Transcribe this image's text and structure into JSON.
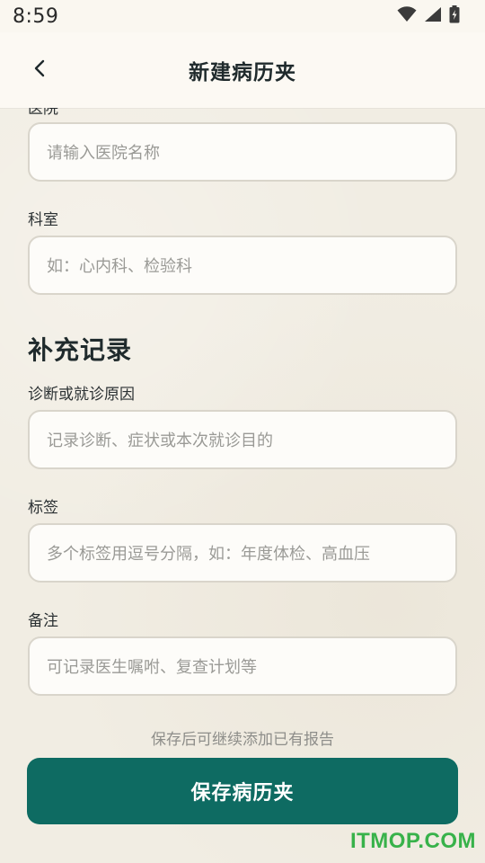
{
  "status_bar": {
    "time": "8:59",
    "icons": [
      "wifi-icon",
      "signal-icon",
      "battery-icon"
    ]
  },
  "app_bar": {
    "title": "新建病历夹",
    "back_icon": "back-arrow-icon"
  },
  "form": {
    "hospital": {
      "label": "医院",
      "placeholder": "请输入医院名称"
    },
    "department": {
      "label": "科室",
      "placeholder": "如：心内科、检验科"
    },
    "supplement_section_title": "补充记录",
    "diagnosis": {
      "label": "诊断或就诊原因",
      "placeholder": "记录诊断、症状或本次就诊目的"
    },
    "tags": {
      "label": "标签",
      "placeholder": "多个标签用逗号分隔，如：年度体检、高血压"
    },
    "notes": {
      "label": "备注",
      "placeholder": "可记录医生嘱咐、复查计划等"
    }
  },
  "footer": {
    "hint": "保存后可继续添加已有报告",
    "save_label": "保存病历夹"
  },
  "watermark": "ITMOP.COM",
  "colors": {
    "primary": "#0e6b62",
    "background": "#f1ede3",
    "watermark": "#38b24a"
  }
}
